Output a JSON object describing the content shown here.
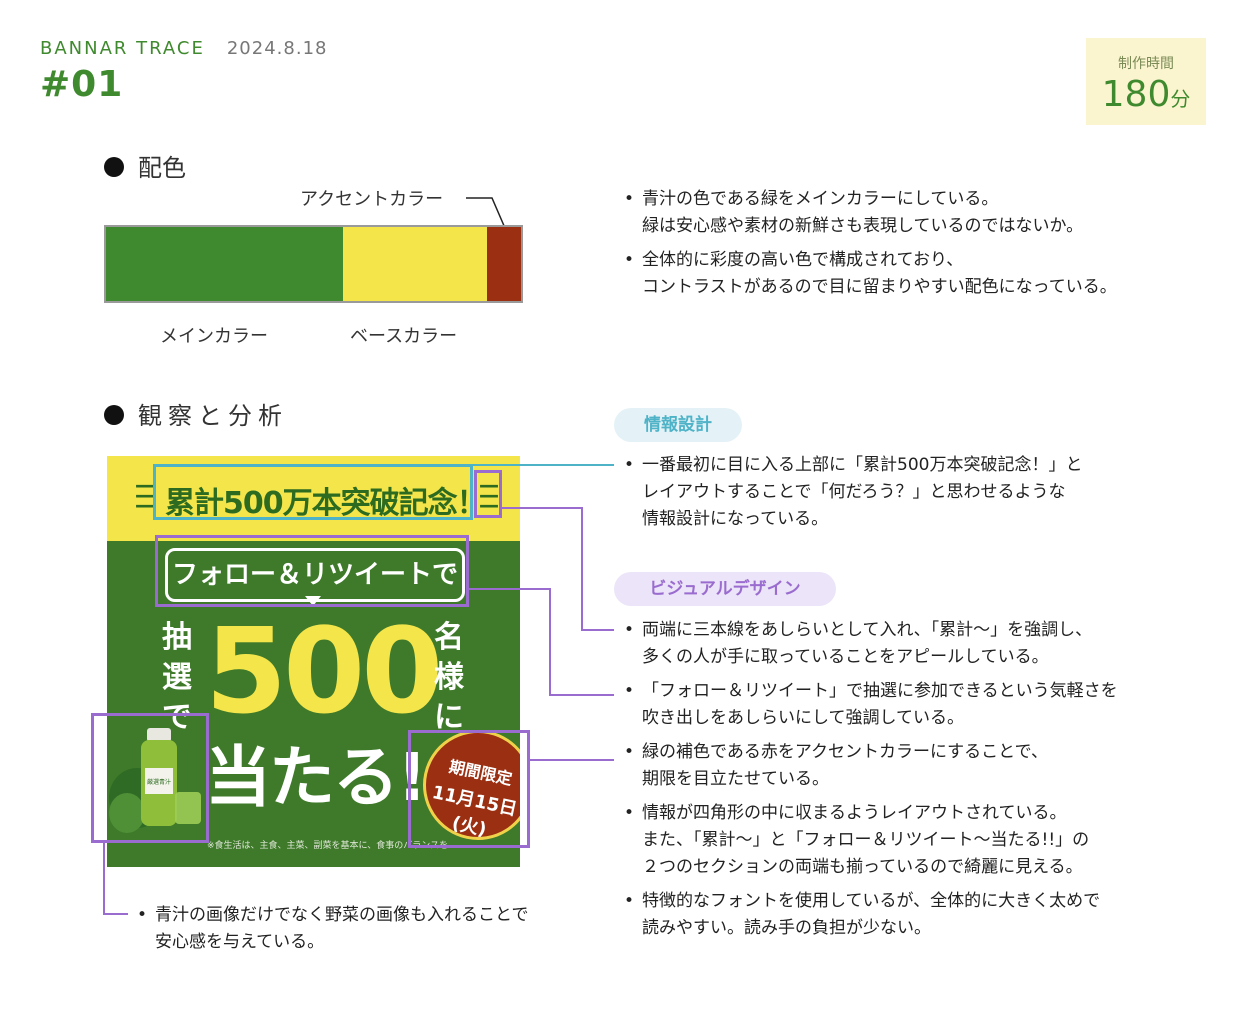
{
  "header": {
    "brand": "BANNAR TRACE",
    "date": "2024.8.18",
    "number": "#01",
    "time_label": "制作時間",
    "time_value": "180",
    "time_unit": "分"
  },
  "palette_section": {
    "heading": "配色",
    "accent_label": "アクセントカラー",
    "main_label": "メインカラー",
    "base_label": "ベースカラー",
    "colors": {
      "main": "#3f8a2e",
      "base": "#f4e54b",
      "accent": "#9b2f12"
    },
    "notes": [
      "青汁の色である緑をメインカラーにしている。",
      "緑は安心感や素材の新鮮さも表現しているのではないか。",
      "全体的に彩度の高い色で構成されており、",
      "コントラストがあるので目に留まりやすい配色になっている。"
    ]
  },
  "analysis_section": {
    "heading": "観察と分析",
    "pill_info": "情報設計",
    "pill_visual": "ビジュアルデザイン",
    "info_note": [
      "一番最初に目に入る上部に「累計500万本突破記念！」と",
      "レイアウトすることで「何だろう？」と思わせるような",
      "情報設計になっている。"
    ],
    "visual_notes": [
      [
        "両端に三本線をあしらいとして入れ、「累計〜」を強調し、",
        "多くの人が手に取っていることをアピールしている。"
      ],
      [
        "「フォロー＆リツイート」で抽選に参加できるという気軽さを",
        "吹き出しをあしらいにして強調している。"
      ],
      [
        "緑の補色である赤をアクセントカラーにすることで、",
        "期限を目立たせている。"
      ],
      [
        "情報が四角形の中に収まるようレイアウトされている。",
        "また、「累計〜」と「フォロー＆リツイート〜当たる!!」の",
        "２つのセクションの両端も揃っているので綺麗に見える。"
      ],
      [
        "特徴的なフォントを使用しているが、全体的に大きく太めで",
        "読みやすい。読み手の負担が少ない。"
      ]
    ],
    "image_note": [
      "青汁の画像だけでなく野菜の画像も入れることで",
      "安心感を与えている。"
    ],
    "colors": {
      "info": "#4fb3c8",
      "visual": "#9a6ccf",
      "info_pill_bg": "#e4f2f7",
      "visual_pill_bg": "#ece4f8"
    }
  },
  "banner": {
    "top_text": "累計500万本突破記念！",
    "bubble_text": "フォロー＆リツイートで",
    "left_vertical": "抽選で",
    "big_number": "500",
    "right_vertical": "名様に",
    "win_text": "当たる!!",
    "seal_line1": "期間限定",
    "seal_line2": "11月15日(火)",
    "fine_print": "※食生活は、主食、主菜、副菜を基本に、食事のバランスを",
    "product_label": "厳選青汁"
  }
}
